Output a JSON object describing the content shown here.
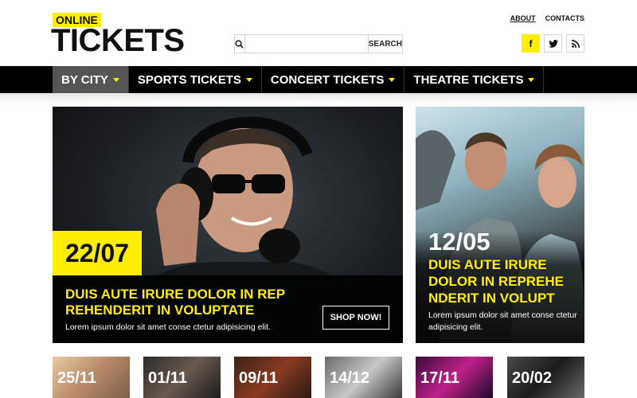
{
  "header": {
    "logo_top": "ONLINE",
    "logo_main": "TICKETS",
    "search": {
      "placeholder": "",
      "value": "",
      "button": "SEARCH"
    },
    "links": [
      "ABOUT",
      "CONTACTS"
    ],
    "social": [
      "facebook-icon",
      "twitter-icon",
      "rss-icon"
    ]
  },
  "nav": {
    "items": [
      "BY CITY",
      "SPORTS TICKETS",
      "CONCERT TICKETS",
      "THEATRE TICKETS"
    ]
  },
  "hero_main": {
    "date": "22/07",
    "title": "DUIS AUTE IRURE DOLOR IN REP REHENDERIT IN VOLUPTATE",
    "subtitle": "Lorem ipsum dolor sit amet conse ctetur adipisicing elit.",
    "button": "SHOP NOW!"
  },
  "hero_side": {
    "date": "12/05",
    "title": "DUIS AUTE IRURE DOLOR IN REPREHE NDERIT IN VOLUPT",
    "subtitle": "Lorem ipsum dolor sit amet conse ctetur adipisicing elit."
  },
  "thumbnails": [
    {
      "date": "25/11"
    },
    {
      "date": "01/11"
    },
    {
      "date": "09/11"
    },
    {
      "date": "14/12"
    },
    {
      "date": "17/11"
    },
    {
      "date": "20/02"
    }
  ],
  "colors": {
    "accent": "#ffee00",
    "nav_bg": "#000000",
    "nav_active": "#555555"
  }
}
